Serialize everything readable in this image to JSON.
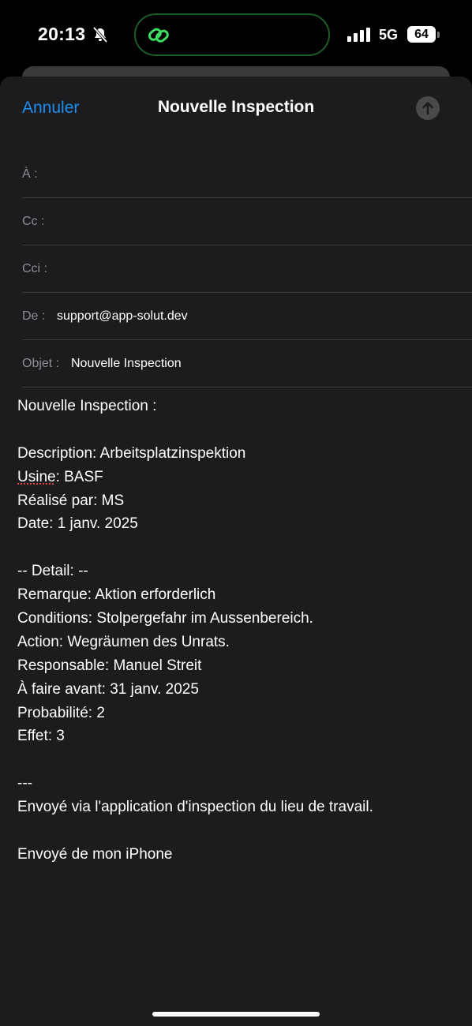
{
  "status_bar": {
    "time": "20:13",
    "network": "5G",
    "battery": "64"
  },
  "nav": {
    "cancel_label": "Annuler",
    "title": "Nouvelle Inspection"
  },
  "fields": {
    "to_label": "À :",
    "cc_label": "Cc :",
    "bcc_label": "Cci :",
    "from_label": "De :",
    "from_value": "support@app-solut.dev",
    "subject_label": "Objet :",
    "subject_value": "Nouvelle Inspection"
  },
  "body": {
    "heading": "Nouvelle Inspection :",
    "description": "Description: Arbeitsplatzinspektion",
    "usine_key": "Usine",
    "usine_value": ": BASF",
    "realise": "Réalisé par: MS",
    "date": "Date: 1 janv. 2025",
    "detail_header": "-- Detail: --",
    "remarque": "Remarque: Aktion erforderlich",
    "conditions": "Conditions: Stolpergefahr im Aussenbereich.",
    "action": "Action: Wegräumen des Unrats.",
    "responsable": "Responsable: Manuel Streit",
    "a_faire": "À faire avant: 31 janv. 2025",
    "probabilite": "Probabilité: 2",
    "effet": "Effet: 3",
    "separator": "---",
    "footer": "Envoyé via l'application d'inspection du lieu de travail.",
    "signature": "Envoyé de mon iPhone"
  },
  "colors": {
    "accent": "#1e8cf0",
    "sheet_background": "#1c1c1e",
    "label_gray": "#8e8e93"
  }
}
